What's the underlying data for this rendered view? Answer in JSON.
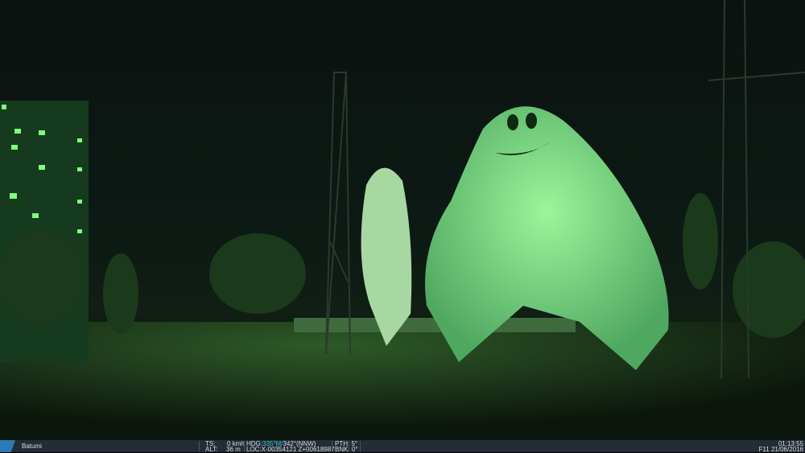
{
  "status_bar": {
    "location": "Batumi",
    "ts_label": "TS:",
    "ts_value": "0",
    "ts_unit": "kmh",
    "alt_label": "ALT:",
    "alt_value": "36",
    "alt_unit": "m",
    "hdg_label": "HDG:",
    "hdg_mag": "335°M/",
    "hdg_true": "342°(NNW)",
    "loc_label": "LOC:",
    "loc_value": "X-00354121 Z+00618987",
    "pth": "PTH: 5°",
    "bnk": "BNK: 0°",
    "time": "01:13:55",
    "date": "F11 21/06/2016"
  },
  "colors": {
    "glow": "#6cff7a",
    "bar": "#232d38",
    "accent": "#37c7c7"
  }
}
